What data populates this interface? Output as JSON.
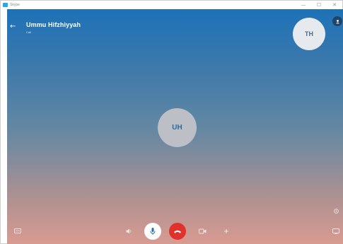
{
  "window": {
    "title": "Skype",
    "controls": [
      {
        "name": "minimize",
        "glyph": "—"
      },
      {
        "name": "maximize",
        "glyph": "☐"
      },
      {
        "name": "close",
        "glyph": "✕"
      }
    ]
  },
  "call": {
    "callee_name": "Ummu Hifzhiyyah",
    "status": "Call",
    "remote_initials": "UH",
    "self_initials": "TH"
  },
  "icons": {
    "back": "←",
    "chat": "chat-icon",
    "settings": "gear-icon",
    "volume": "speaker-icon",
    "mic": "microphone-icon",
    "hangup": "hang-up-icon",
    "video": "video-camera-icon",
    "add": "plus-icon",
    "screen": "screen-icon"
  },
  "colors": {
    "accent": "#1d72b8",
    "hangup": "#e0312b",
    "avatar_text": "#2f6a9e"
  }
}
